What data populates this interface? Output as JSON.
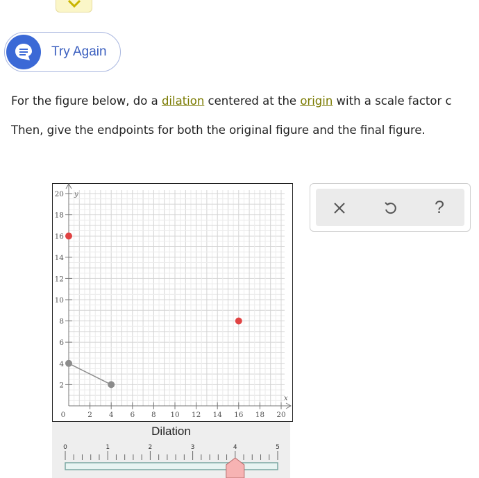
{
  "try_again": {
    "label": "Try Again"
  },
  "question": {
    "line1_before": "For the figure below, do a ",
    "link_dilation": "dilation",
    "line1_middle": " centered at the ",
    "link_origin": "origin",
    "line1_after": " with a scale factor c",
    "line2": "Then, give the endpoints for both the original figure and the final figure."
  },
  "graph": {
    "x_axis_label": "x",
    "y_axis_label": "y",
    "x_range": [
      0,
      20
    ],
    "y_range": [
      0,
      20
    ],
    "x_ticks": [
      0,
      2,
      4,
      6,
      8,
      10,
      12,
      14,
      16,
      18,
      20
    ],
    "y_ticks": [
      2,
      4,
      6,
      8,
      10,
      12,
      14,
      16,
      18,
      20
    ],
    "segment": {
      "from": [
        0,
        4
      ],
      "to": [
        4,
        2
      ],
      "color": "#8c8c8c"
    },
    "points": [
      {
        "x": 0,
        "y": 4,
        "color": "#8c8c8c"
      },
      {
        "x": 4,
        "y": 2,
        "color": "#8c8c8c"
      },
      {
        "x": 0,
        "y": 16,
        "color": "#e04343"
      },
      {
        "x": 16,
        "y": 8,
        "color": "#e04343"
      }
    ]
  },
  "tools": {
    "clear_icon": "close-icon",
    "undo_icon": "undo-icon",
    "help_label": "?"
  },
  "slider": {
    "title": "Dilation",
    "labels": [
      "0",
      "1",
      "2",
      "3",
      "4",
      "5"
    ],
    "min": 0,
    "max": 5,
    "value": 4,
    "thumb_color": "#f7b3b3"
  },
  "colors": {
    "accent": "#3b69d6",
    "link": "#7a7a00"
  }
}
